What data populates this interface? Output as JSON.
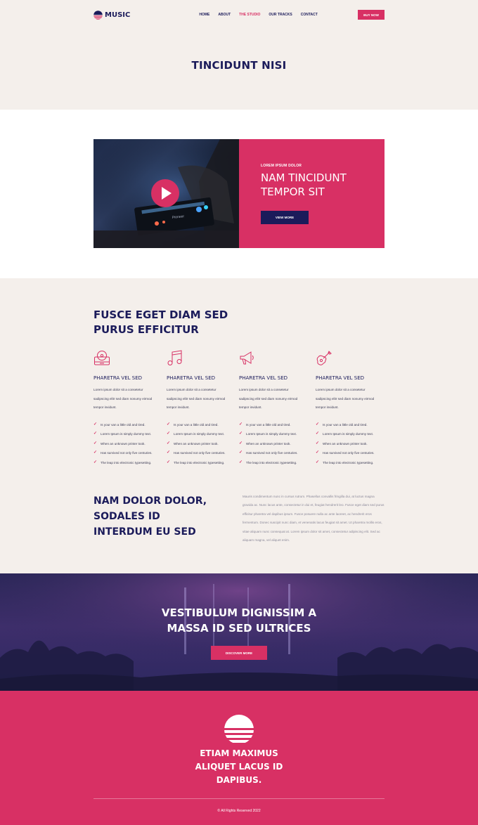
{
  "brand": {
    "name": "MUSIC"
  },
  "nav": {
    "items": [
      {
        "label": "HOME"
      },
      {
        "label": "ABOUT"
      },
      {
        "label": "THE STUDIO"
      },
      {
        "label": "OUR TRACKS"
      },
      {
        "label": "CONTACT"
      }
    ],
    "active": "THE STUDIO",
    "cta": "BUY NOW"
  },
  "hero": {
    "title": "TINCIDUNT NISI"
  },
  "feature": {
    "kicker": "LOREM IPSUM DOLOR",
    "heading": "NAM TINCIDUNT TEMPOR SIT",
    "button": "VIEW MORE",
    "image_text": "Pioneer"
  },
  "services": {
    "title": "FUSCE EGET DIAM SED PURUS EFFICITUR",
    "columns": [
      {
        "icon": "vinyl-record-player-icon",
        "title": "PHARETRA VEL SED",
        "text": "Lorem ipsum dolor sit a consetetur sadipscing elitr sed diam nonumy eirmod tempor invidunt.",
        "items": [
          "Is your van a little old and tired.",
          "Lorem Ipsum is simply dummy text.",
          "When an unknown printer took.",
          "Has survived not only five centuries.",
          "The leap into electronic typesetting."
        ]
      },
      {
        "icon": "music-note-icon",
        "title": "PHARETRA VEL SED",
        "text": "Lorem ipsum dolor sit a consetetur sadipscing elitr sed diam nonumy eirmod tempor invidunt.",
        "items": [
          "Is your van a little old and tired.",
          "Lorem Ipsum is simply dummy text.",
          "When an unknown printer took.",
          "Has survived not only five centuries.",
          "The leap into electronic typesetting."
        ]
      },
      {
        "icon": "megaphone-icon",
        "title": "PHARETRA VEL SED",
        "text": "Lorem ipsum dolor sit a consetetur sadipscing elitr sed diam nonumy eirmod tempor invidunt.",
        "items": [
          "Is your van a little old and tired.",
          "Lorem Ipsum is simply dummy text.",
          "When an unknown printer took.",
          "Has survived not only five centuries.",
          "The leap into electronic typesetting."
        ]
      },
      {
        "icon": "guitar-icon",
        "title": "PHARETRA VEL SED",
        "text": "Lorem ipsum dolor sit a consetetur sadipscing elitr sed diam nonumy eirmod tempor invidunt.",
        "items": [
          "Is your van a little old and tired.",
          "Lorem Ipsum is simply dummy text.",
          "When an unknown printer took.",
          "Has survived not only five centuries.",
          "The leap into electronic typesetting."
        ]
      }
    ],
    "nam_title": "NAM DOLOR DOLOR, SODALES ID INTERDUM EU SED",
    "nam_text": "Mauris condimentum nunc in cursus rutrum. Phasellus convallis fringilla dui, at luctus magna gravida ac. Nunc lacus ante, consectetur in dui et, feugiat hendrerit leo. Fusce eget diam sed purus efficitur pharetra vel dapibus ipsum. Fusce posuere nulla ac ante laoreet, ac hendrerit eros fermentum. Donec suscipit nunc diam, et venenatis lacus feugiat sit amet. Ut pharetra mollis eros, vitae aliquam nunc consequat at. Lorem ipsum dolor sit amet, consectetur adipiscing elit. Sed ac aliquam magna, vel aliquet enim."
  },
  "concert": {
    "title": "VESTIBULUM DIGNISSIM A MASSA ID SED ULTRICES",
    "button": "DISCOVER MORE"
  },
  "footer": {
    "title": "ETIAM MAXIMUS ALIQUET LACUS ID DAPIBUS.",
    "copyright": "© All Rights Reserved 2022"
  },
  "colors": {
    "navy": "#1b1b5a",
    "pink": "#d83064",
    "beige": "#f4efeb"
  }
}
